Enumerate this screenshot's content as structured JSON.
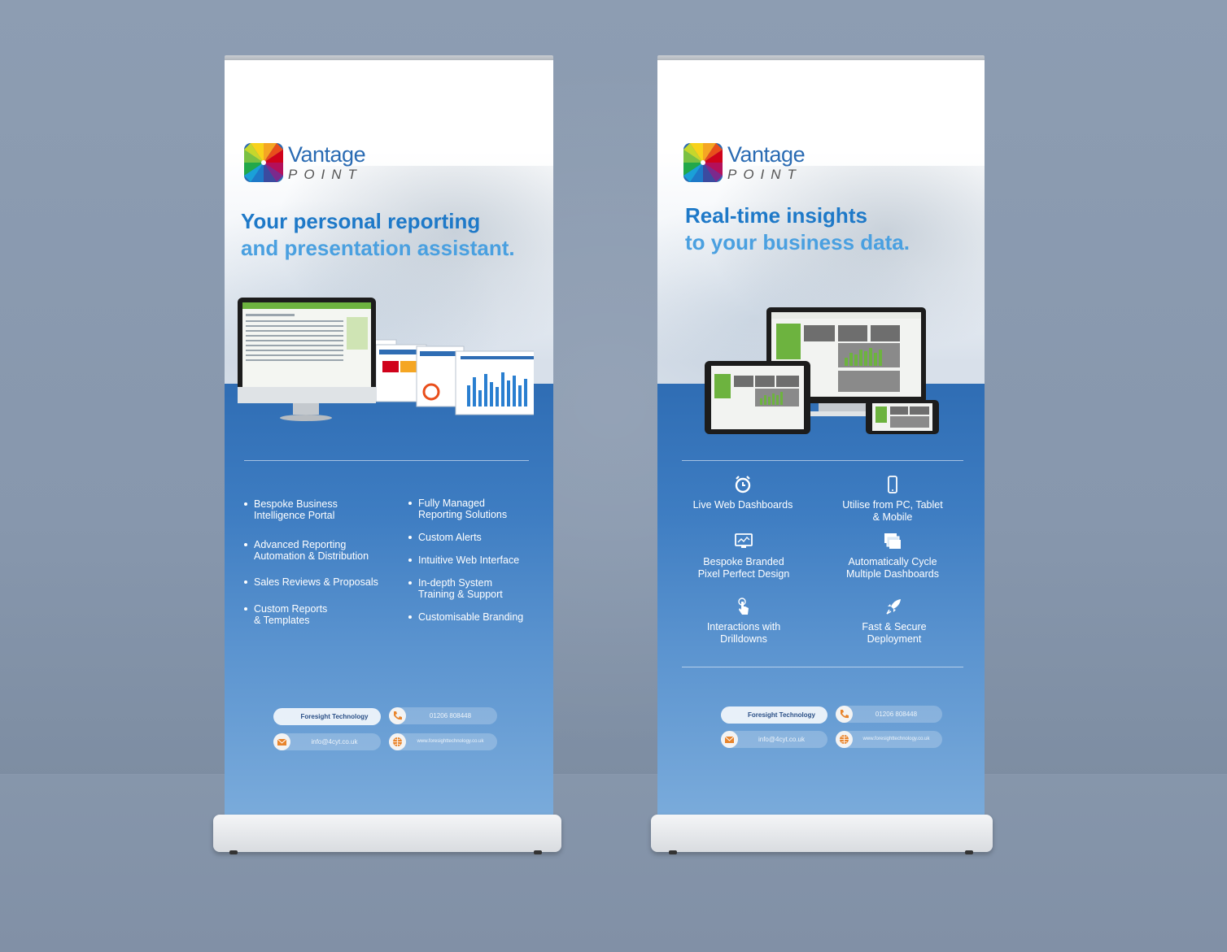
{
  "left_banner": {
    "logo": {
      "word": "Vantage",
      "sub": "POINT"
    },
    "headline": [
      "Your personal reporting",
      "and presentation assistant."
    ],
    "bullets_col1": [
      [
        "Bespoke Business",
        "Intelligence Portal"
      ],
      [
        "Advanced Reporting",
        "Automation & Distribution"
      ],
      [
        "Sales Reviews & Proposals"
      ],
      [
        "Custom Reports",
        "& Templates"
      ]
    ],
    "bullets_col2": [
      [
        "Fully Managed",
        "Reporting Solutions"
      ],
      [
        "Custom Alerts"
      ],
      [
        "Intuitive Web Interface"
      ],
      [
        "In-depth System",
        "Training & Support"
      ],
      [
        "Customisable Branding"
      ]
    ],
    "contacts": {
      "company": "Foresight Technology",
      "phone": "01206 808448",
      "email": "info@4cyt.co.uk",
      "web": "www.foresighttechnology.co.uk"
    }
  },
  "right_banner": {
    "logo": {
      "word": "Vantage",
      "sub": "POINT"
    },
    "headline": [
      "Real-time insights",
      "to your business data."
    ],
    "features": [
      {
        "icon": "alarm-clock-icon",
        "lines": [
          "Live Web Dashboards"
        ]
      },
      {
        "icon": "mobile-phone-icon",
        "lines": [
          "Utilise from PC, Tablet",
          "& Mobile"
        ]
      },
      {
        "icon": "monitor-icon",
        "lines": [
          "Bespoke Branded",
          "Pixel Perfect Design"
        ]
      },
      {
        "icon": "stacked-screens-icon",
        "lines": [
          "Automatically Cycle",
          "Multiple Dashboards"
        ]
      },
      {
        "icon": "touch-hand-icon",
        "lines": [
          "Interactions with",
          "Drilldowns"
        ]
      },
      {
        "icon": "rocket-icon",
        "lines": [
          "Fast & Secure",
          "Deployment"
        ]
      }
    ],
    "contacts": {
      "company": "Foresight Technology",
      "phone": "01206 808448",
      "email": "info@4cyt.co.uk",
      "web": "www.foresighttechnology.co.uk"
    }
  },
  "colors": {
    "brand_blue": "#1e79c8",
    "headline_light": "#4aa0e0",
    "panel_blue": "#2f6db4",
    "accent_orange": "#e8842c"
  }
}
